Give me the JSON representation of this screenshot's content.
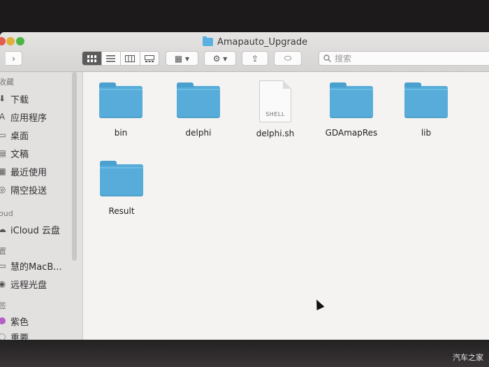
{
  "window": {
    "title": "Amapauto_Upgrade"
  },
  "toolbar": {
    "nav_back_glyph": "‹",
    "nav_forward_glyph": "›",
    "view_icons": [
      "grid-view-icon",
      "list-view-icon",
      "column-view-icon",
      "gallery-view-icon"
    ],
    "arrange_label": "▦ ▾",
    "action_label": "⚙ ▾",
    "share_glyph": "⇪",
    "tag_glyph": "⬭",
    "search_placeholder": "搜索"
  },
  "sidebar": {
    "sections": [
      {
        "header": "收藏",
        "items": [
          {
            "label": "下载",
            "icon": "download-icon"
          },
          {
            "label": "应用程序",
            "icon": "applications-icon"
          },
          {
            "label": "桌面",
            "icon": "desktop-icon"
          },
          {
            "label": "文稿",
            "icon": "documents-icon"
          },
          {
            "label": "最近使用",
            "icon": "recents-icon"
          },
          {
            "label": "隔空投送",
            "icon": "airdrop-icon"
          }
        ]
      },
      {
        "header": "oud",
        "items": [
          {
            "label": "iCloud 云盘",
            "icon": "cloud-icon"
          }
        ]
      },
      {
        "header": "置",
        "items": [
          {
            "label": "慧的MacB...",
            "icon": "laptop-icon"
          },
          {
            "label": "远程光盘",
            "icon": "disc-icon"
          }
        ]
      },
      {
        "header": "签",
        "items": [
          {
            "label": "紫色",
            "icon": "purple-tag-icon",
            "color": "#b45ec7"
          },
          {
            "label": "重要",
            "icon": "gray-tag-icon"
          }
        ]
      }
    ]
  },
  "files": [
    {
      "name": "bin",
      "kind": "folder"
    },
    {
      "name": "delphi",
      "kind": "folder"
    },
    {
      "name": "delphi.sh",
      "kind": "shell",
      "badge": "SHELL"
    },
    {
      "name": "GDAmapRes",
      "kind": "folder"
    },
    {
      "name": "lib",
      "kind": "folder"
    },
    {
      "name": "Result",
      "kind": "folder"
    }
  ],
  "watermark": "汽车之家",
  "colors": {
    "folder": "#57acd9",
    "accent_active": "#5b5b5b"
  }
}
